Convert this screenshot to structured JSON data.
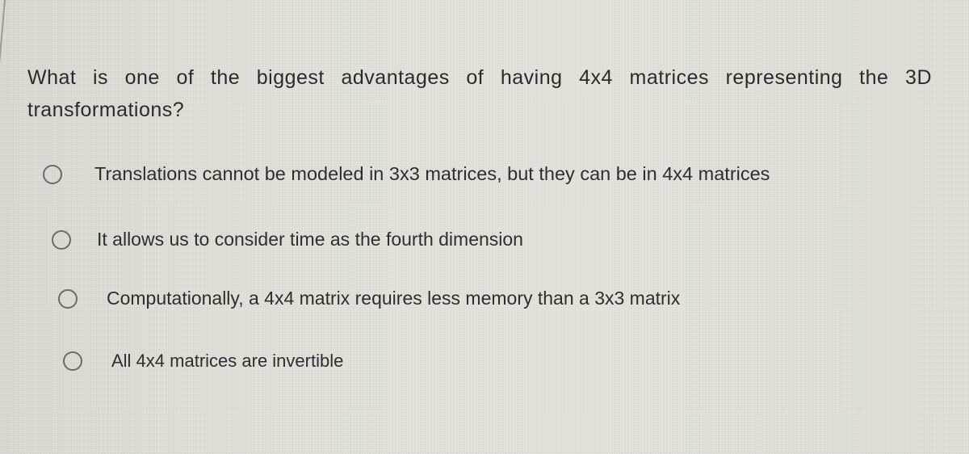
{
  "question": {
    "text_line1": "What is one of the biggest advantages of having 4x4 matrices representing the 3D",
    "text_line2": "transformations?"
  },
  "options": [
    {
      "label": "Translations cannot be modeled in 3x3 matrices, but they can be in 4x4 matrices",
      "selected": false
    },
    {
      "label": "It allows us to consider time as the fourth dimension",
      "selected": false
    },
    {
      "label": "Computationally, a 4x4 matrix requires less memory than a 3x3 matrix",
      "selected": false
    },
    {
      "label": "All 4x4 matrices are invertible",
      "selected": false
    }
  ]
}
